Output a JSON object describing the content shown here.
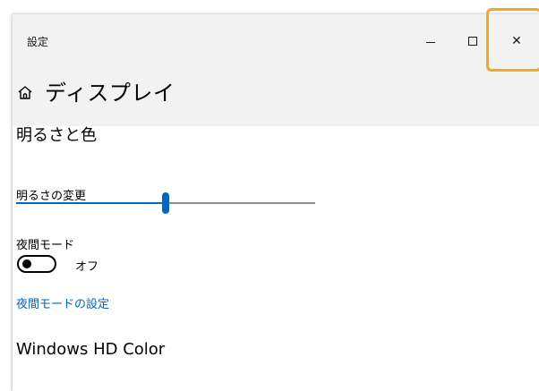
{
  "window": {
    "title": "設定",
    "minimize_icon": "minimize-icon",
    "maximize_icon": "maximize-icon",
    "close_icon": "close-icon",
    "close_glyph": "✕"
  },
  "header": {
    "home_icon": "home-icon",
    "title": "ディスプレイ"
  },
  "brightness_section": {
    "title": "明るさと色",
    "brightness_label": "明るさの変更",
    "brightness_value": 0.5,
    "night_light_label": "夜間モード",
    "night_light_state": "オフ",
    "night_light_on": false,
    "night_light_settings_link": "夜間モードの設定"
  },
  "hd_section": {
    "title": "Windows HD Color"
  },
  "colors": {
    "accent": "#0067c0",
    "titlebar_bg": "#f2f2f2",
    "highlight": "#f5a623"
  }
}
